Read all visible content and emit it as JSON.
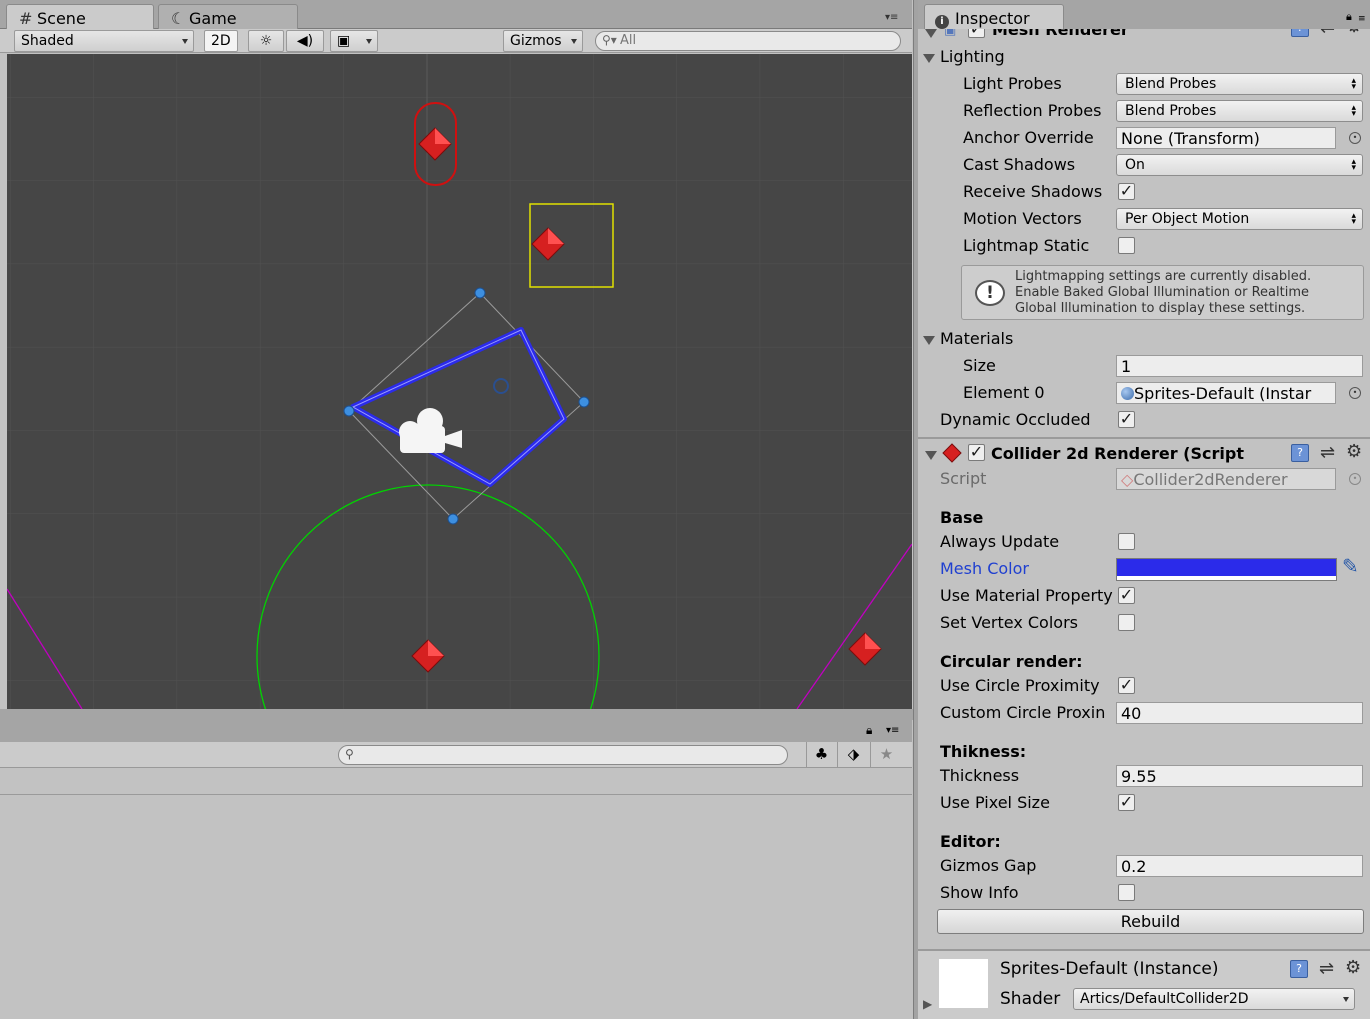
{
  "scene_tabs": {
    "scene": "Scene",
    "game": "Game"
  },
  "scene_toolbar": {
    "shading": "Shaded",
    "mode_2d": "2D",
    "gizmos": "Gizmos",
    "search_placeholder": "All"
  },
  "inspector_tab": "Inspector",
  "mesh_renderer": {
    "title": "Mesh Renderer",
    "lighting": {
      "header": "Lighting",
      "light_probes_label": "Light Probes",
      "light_probes_value": "Blend Probes",
      "reflection_probes_label": "Reflection Probes",
      "reflection_probes_value": "Blend Probes",
      "anchor_override_label": "Anchor Override",
      "anchor_override_value": "None (Transform)",
      "cast_shadows_label": "Cast Shadows",
      "cast_shadows_value": "On",
      "receive_shadows_label": "Receive Shadows",
      "motion_vectors_label": "Motion Vectors",
      "motion_vectors_value": "Per Object Motion",
      "lightmap_static_label": "Lightmap Static",
      "info_line1": "Lightmapping settings are currently disabled.",
      "info_line2": "Enable Baked Global Illumination or Realtime",
      "info_line3": "Global Illumination to display these settings."
    },
    "materials": {
      "header": "Materials",
      "size_label": "Size",
      "size_value": "1",
      "element0_label": "Element 0",
      "element0_value": "Sprites-Default (Instar"
    },
    "dynamic_occluded_label": "Dynamic Occluded"
  },
  "collider_renderer": {
    "title": "Collider 2d Renderer (Script",
    "script_label": "Script",
    "script_value": "Collider2dRenderer",
    "base_header": "Base",
    "always_update_label": "Always Update",
    "mesh_color_label": "Mesh Color",
    "mesh_color": "#2b2bea",
    "use_material_property_label": "Use Material Property",
    "set_vertex_colors_label": "Set Vertex Colors",
    "circular_header": "Circular render:",
    "use_circle_proximity_label": "Use Circle Proximity",
    "custom_circle_label": "Custom Circle Proxin",
    "custom_circle_value": "40",
    "thikness_header": "Thikness:",
    "thickness_label": "Thickness",
    "thickness_value": "9.55",
    "use_pixel_size_label": "Use Pixel Size",
    "editor_header": "Editor:",
    "gizmos_gap_label": "Gizmos Gap",
    "gizmos_gap_value": "0.2",
    "show_info_label": "Show Info",
    "rebuild_label": "Rebuild"
  },
  "material_preview": {
    "name": "Sprites-Default (Instance)",
    "shader_label": "Shader",
    "shader_value": "Artics/DefaultCollider2D"
  },
  "colors": {
    "scene_bg": "#464646",
    "mesh_outline": "#2b2bea",
    "circle": "#00d400",
    "capsule": "#d01010",
    "box": "#e0e000",
    "edge": "#c000c0"
  }
}
